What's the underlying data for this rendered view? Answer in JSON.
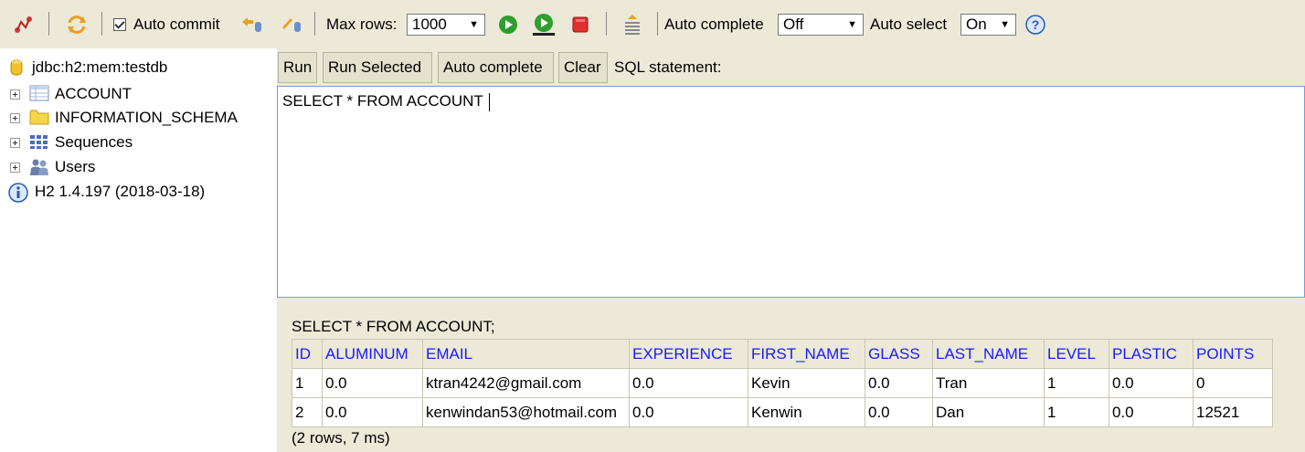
{
  "toolbar": {
    "auto_commit_label": "Auto commit",
    "max_rows_label": "Max rows:",
    "max_rows_value": "1000",
    "auto_complete_label": "Auto complete",
    "auto_complete_value": "Off",
    "auto_select_label": "Auto select",
    "auto_select_value": "On"
  },
  "tree": {
    "connection": "jdbc:h2:mem:testdb",
    "items": [
      {
        "label": "ACCOUNT",
        "icon": "table-icon"
      },
      {
        "label": "INFORMATION_SCHEMA",
        "icon": "folder-icon"
      },
      {
        "label": "Sequences",
        "icon": "sequences-icon"
      },
      {
        "label": "Users",
        "icon": "users-icon"
      }
    ],
    "version": "H2 1.4.197 (2018-03-18)"
  },
  "query_bar": {
    "run": "Run",
    "run_selected": "Run Selected",
    "auto_complete": "Auto complete",
    "clear": "Clear",
    "sql_label": "SQL statement:"
  },
  "editor": {
    "text": "SELECT * FROM ACCOUNT"
  },
  "results": {
    "query": "SELECT * FROM ACCOUNT;",
    "columns": [
      "ID",
      "ALUMINUM",
      "EMAIL",
      "EXPERIENCE",
      "FIRST_NAME",
      "GLASS",
      "LAST_NAME",
      "LEVEL",
      "PLASTIC",
      "POINTS"
    ],
    "rows": [
      [
        "1",
        "0.0",
        "ktran4242@gmail.com",
        "0.0",
        "Kevin",
        "0.0",
        "Tran",
        "1",
        "0.0",
        "0"
      ],
      [
        "2",
        "0.0",
        "kenwindan53@hotmail.com",
        "0.0",
        "Kenwin",
        "0.0",
        "Dan",
        "1",
        "0.0",
        "12521"
      ]
    ],
    "summary": "(2 rows, 7 ms)"
  },
  "colors": {
    "toolbar_bg": "#ece9d8",
    "header_text": "#1a1aff",
    "stop_red": "#e03030",
    "run_green": "#2e9e2e"
  }
}
